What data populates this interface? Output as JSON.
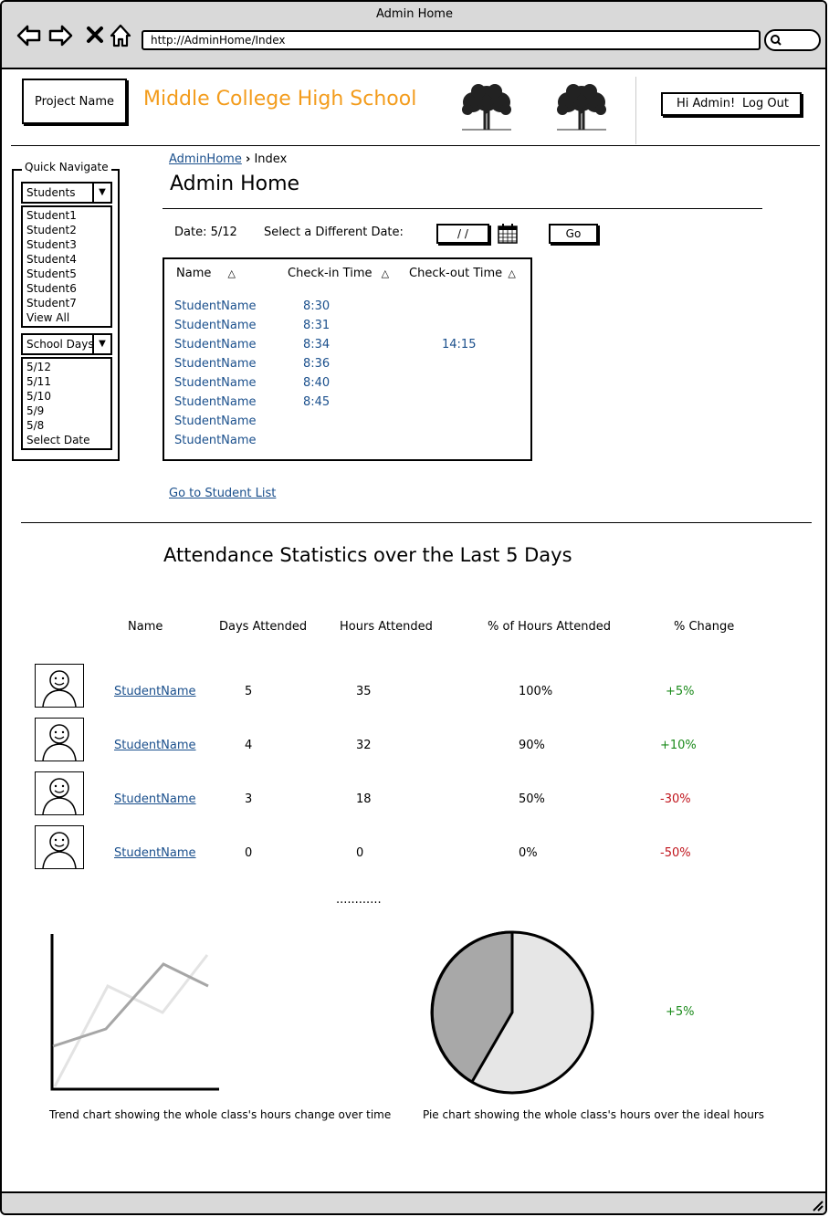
{
  "window": {
    "title": "Admin Home",
    "url": "http://AdminHome/Index"
  },
  "header": {
    "project_name": "Project Name",
    "school_name": "Middle College High School",
    "greeting": "Hi Admin!",
    "logout": "Log Out"
  },
  "quick_nav": {
    "title": "Quick Navigate",
    "students_combo": "Students",
    "students": [
      "Student1",
      "Student2",
      "Student3",
      "Student4",
      "Student5",
      "Student6",
      "Student7",
      "View All"
    ],
    "days_combo": "School Days",
    "days": [
      "5/12",
      "5/11",
      "5/10",
      "5/9",
      "5/8",
      "Select Date"
    ]
  },
  "breadcrumb": {
    "home": "AdminHome",
    "current": "Index"
  },
  "page_title": "Admin Home",
  "date_bar": {
    "date_label": "Date: 5/12",
    "select_label": "Select a Different Date:",
    "date_input": "/ /",
    "go": "Go"
  },
  "checkin_table": {
    "headers": [
      "Name",
      "Check-in Time",
      "Check-out Time"
    ],
    "rows": [
      {
        "name": "StudentName",
        "in": "8:30",
        "out": ""
      },
      {
        "name": "StudentName",
        "in": "8:31",
        "out": ""
      },
      {
        "name": "StudentName",
        "in": "8:34",
        "out": "14:15"
      },
      {
        "name": "StudentName",
        "in": "8:36",
        "out": ""
      },
      {
        "name": "StudentName",
        "in": "8:40",
        "out": ""
      },
      {
        "name": "StudentName",
        "in": "8:45",
        "out": ""
      },
      {
        "name": "StudentName",
        "in": "",
        "out": ""
      },
      {
        "name": "StudentName",
        "in": "",
        "out": ""
      }
    ]
  },
  "student_list_link": "Go to Student List",
  "stats": {
    "title": "Attendance Statistics over the Last 5 Days",
    "headers": [
      "Name",
      "Days Attended",
      "Hours Attended",
      "% of Hours Attended",
      "% Change"
    ],
    "rows": [
      {
        "name": "StudentName",
        "days": "5",
        "hours": "35",
        "pct": "100%",
        "change": "+5%",
        "trend": "up"
      },
      {
        "name": "StudentName",
        "days": "4",
        "hours": "32",
        "pct": "90%",
        "change": "+10%",
        "trend": "up"
      },
      {
        "name": "StudentName",
        "days": "3",
        "hours": "18",
        "pct": "50%",
        "change": "-30%",
        "trend": "down"
      },
      {
        "name": "StudentName",
        "days": "0",
        "hours": "0",
        "pct": "0%",
        "change": "-50%",
        "trend": "down"
      }
    ],
    "more": "............"
  },
  "charts": {
    "trend_caption": "Trend chart showing the whole class's hours change over time",
    "pie_caption": "Pie chart showing the whole class's hours over the ideal hours",
    "pie_change": "+5%",
    "colors": {
      "green": "#1a8a1a",
      "red": "#c0141c",
      "link": "#1a4f8c",
      "orange": "#f39c1c"
    }
  }
}
